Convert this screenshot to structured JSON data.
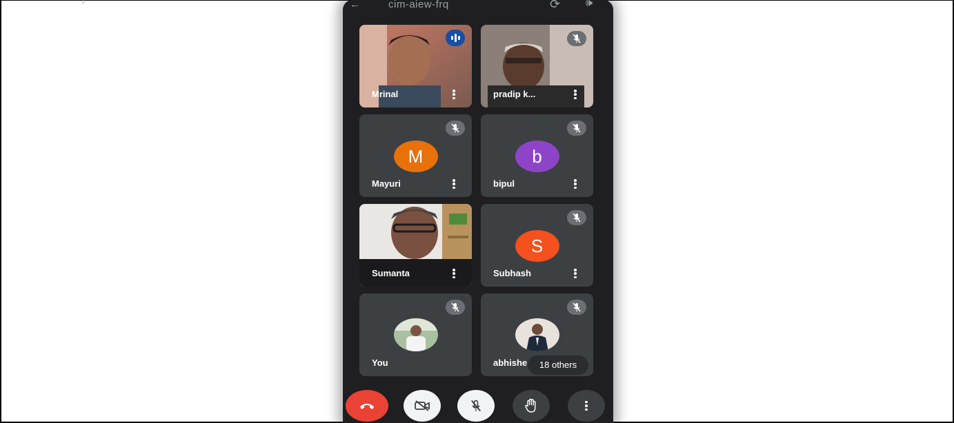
{
  "meeting": {
    "code": "cim-aiew-frq",
    "back_icon": "arrow-left-icon",
    "switch_camera_icon": "switch-camera-icon",
    "speaker_icon": "speaker-icon"
  },
  "participants": [
    {
      "name": "Mrinal",
      "type": "video",
      "muted": false,
      "speaking": true
    },
    {
      "name": "pradip k...",
      "type": "video",
      "muted": true,
      "speaking": false
    },
    {
      "name": "Mayuri",
      "type": "initial",
      "initial": "M",
      "color": "#e8710a",
      "muted": true
    },
    {
      "name": "bipul",
      "type": "initial",
      "initial": "b",
      "color": "#8e44c9",
      "muted": true
    },
    {
      "name": "Sumanta",
      "type": "video",
      "muted": false,
      "speaking": false
    },
    {
      "name": "Subhash",
      "type": "initial",
      "initial": "S",
      "color": "#f4511e",
      "muted": true
    },
    {
      "name": "You",
      "type": "photo",
      "muted": true
    },
    {
      "name": "abhishe",
      "type": "photo",
      "muted": true
    }
  ],
  "others_label": "18 others",
  "controls": {
    "end_call_icon": "end-call-icon",
    "camera_off_icon": "camera-off-icon",
    "mic_off_icon": "mic-off-icon",
    "raise_hand_icon": "raise-hand-icon",
    "more_options_icon": "more-vertical-icon"
  }
}
